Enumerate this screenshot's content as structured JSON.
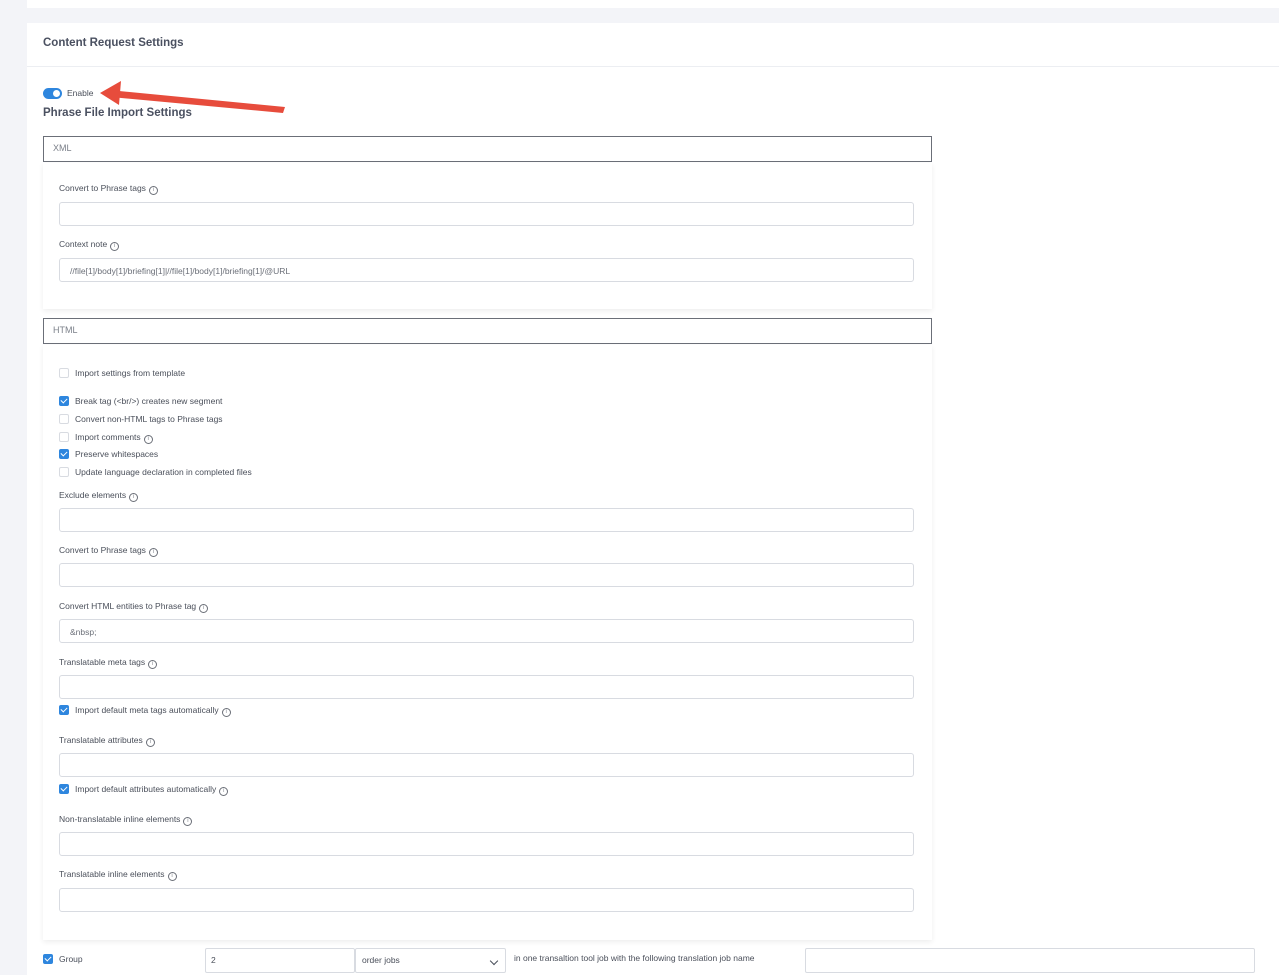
{
  "panel": {
    "title": "Content Request Settings"
  },
  "enable": {
    "label": "Enable",
    "checked": true
  },
  "import_settings": {
    "title": "Phrase File Import Settings"
  },
  "xml": {
    "label": "XML",
    "convert_tags_label": "Convert to Phrase tags",
    "convert_tags_value": "",
    "context_note_label": "Context note",
    "context_note_value": "//file[1]/body[1]/briefing[1]|//file[1]/body[1]/briefing[1]/@URL"
  },
  "html": {
    "label": "HTML",
    "checkboxes": [
      {
        "label": "Import settings from template",
        "checked": false
      },
      {
        "label": "Break tag (<br/>) creates new segment",
        "checked": true
      },
      {
        "label": "Convert non-HTML tags to Phrase tags",
        "checked": false
      },
      {
        "label": "Import comments",
        "checked": false
      },
      {
        "label": "Preserve whitespaces",
        "checked": true
      },
      {
        "label": "Update language declaration in completed files",
        "checked": false
      }
    ],
    "exclude_label": "Exclude elements",
    "exclude_value": "",
    "convert_tags_label": "Convert to Phrase tags",
    "convert_tags_value": "",
    "entities_label": "Convert HTML entities to Phrase tag",
    "entities_value": "&nbsp;",
    "meta_tags_label": "Translatable meta tags",
    "meta_tags_value": "",
    "import_meta_label": "Import default meta tags automatically",
    "import_meta_checked": true,
    "attributes_label": "Translatable attributes",
    "attributes_value": "",
    "import_attr_label": "Import default attributes automatically",
    "import_attr_checked": true,
    "non_translatable_label": "Non-translatable inline elements",
    "non_translatable_value": "",
    "translatable_inline_label": "Translatable inline elements",
    "translatable_inline_value": ""
  },
  "group": {
    "label": "Group",
    "checked": true,
    "count": "2",
    "unit": "order jobs",
    "text": "in one transaltion tool job with the following translation job name",
    "job_name": ""
  },
  "colors": {
    "accent": "#2e86de",
    "arrow": "#e74c3c"
  },
  "icons": {
    "info": "info-icon",
    "chevron": "chevron-down-icon",
    "arrow": "annotation-arrow"
  }
}
